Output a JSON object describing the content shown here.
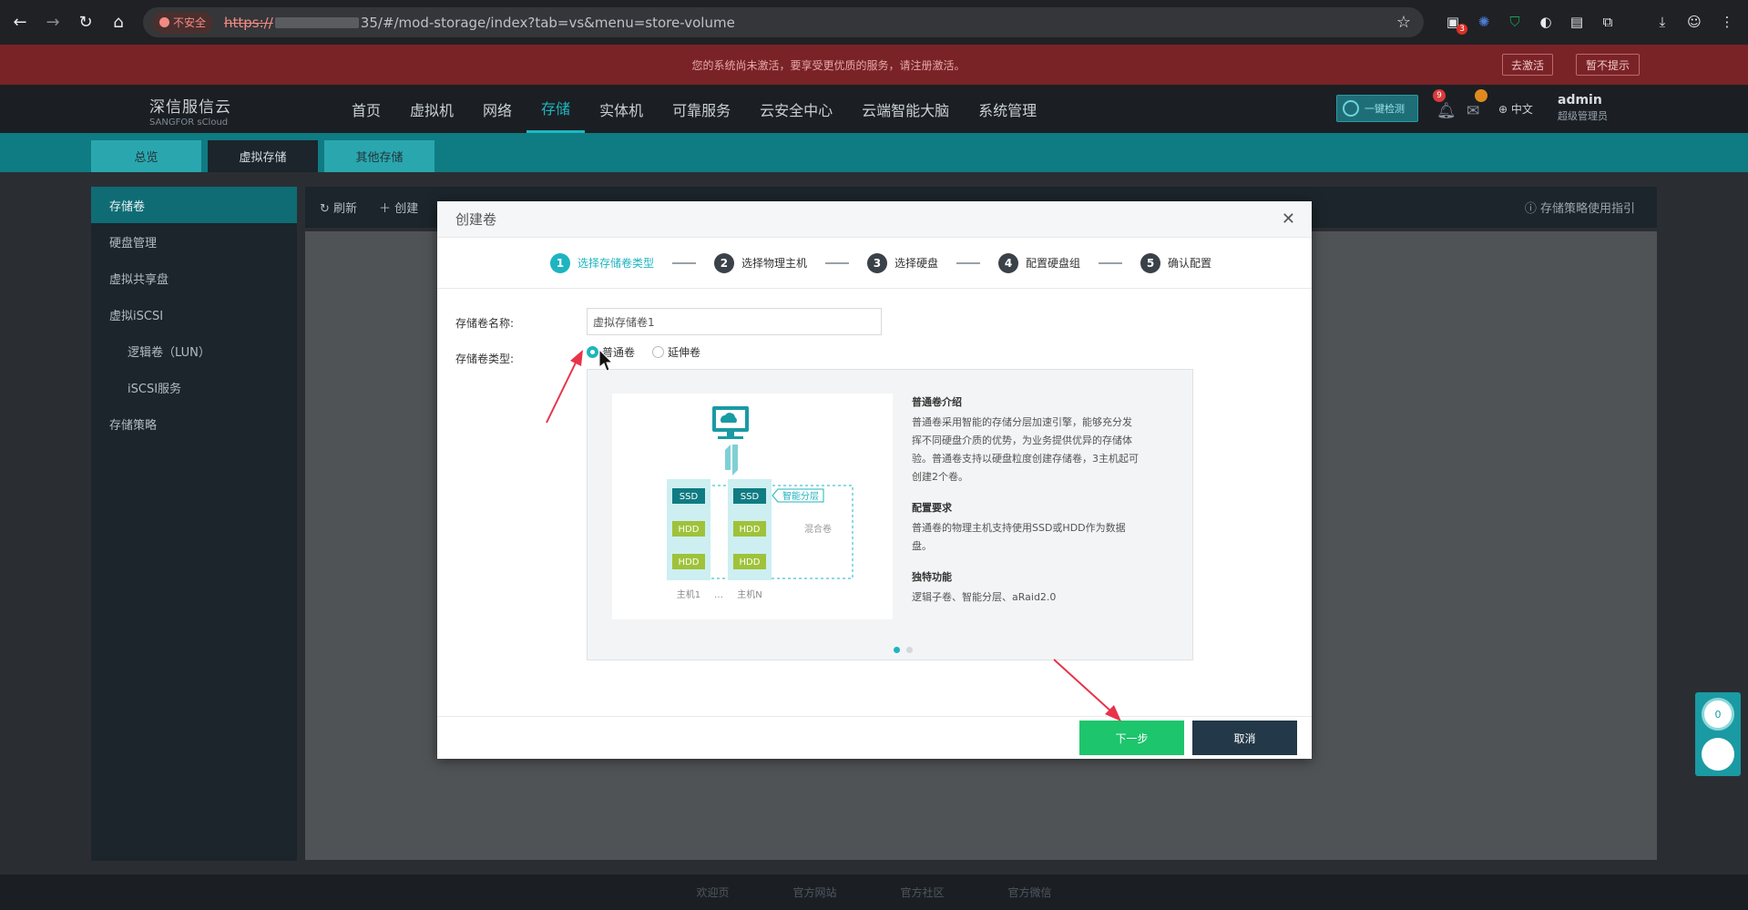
{
  "browser": {
    "insecure_label": "不安全",
    "url_scheme": "https://",
    "url_rest": "35/#/mod-storage/index?tab=vs&menu=store-volume",
    "ext_badge": "3"
  },
  "banner": {
    "text": "您的系统尚未激活，要享受更优质的服务，请注册激活。",
    "activate_label": "去激活",
    "dismiss_label": "暂不提示"
  },
  "header": {
    "brand_cn": "深信服信云",
    "brand_en": "SANGFOR sCloud",
    "nav": [
      "首页",
      "虚拟机",
      "网络",
      "存储",
      "实体机",
      "可靠服务",
      "云安全中心",
      "云端智能大脑",
      "系统管理"
    ],
    "check_label": "一键检测",
    "bell_badge": "9",
    "lang": "中文",
    "user_name": "admin",
    "user_role": "超级管理员"
  },
  "subtabs": [
    "总览",
    "虚拟存储",
    "其他存储"
  ],
  "sidebar": [
    "存储卷",
    "硬盘管理",
    "虚拟共享盘",
    "虚拟iSCSI",
    "逻辑卷（LUN）",
    "iSCSI服务",
    "存储策略"
  ],
  "toolbar": {
    "refresh": "刷新",
    "create": "创建",
    "guide": "存储策略使用指引"
  },
  "footer": [
    "欢迎页",
    "官方网站",
    "官方社区",
    "官方微信"
  ],
  "dialog": {
    "title": "创建卷",
    "steps": [
      {
        "num": "1",
        "label": "选择存储卷类型"
      },
      {
        "num": "2",
        "label": "选择物理主机"
      },
      {
        "num": "3",
        "label": "选择硬盘"
      },
      {
        "num": "4",
        "label": "配置硬盘组"
      },
      {
        "num": "5",
        "label": "确认配置"
      }
    ],
    "name_label": "存储卷名称:",
    "name_value": "虚拟存储卷1",
    "type_label": "存储卷类型:",
    "type_options": [
      "普通卷",
      "延伸卷"
    ],
    "illustration": {
      "ssd": "SSD",
      "hdd": "HDD",
      "tier_label": "智能分层",
      "mixed_label": "混合卷",
      "host1": "主机1",
      "ellipsis": "…",
      "hostN": "主机N"
    },
    "info": [
      {
        "title": "普通卷介绍",
        "body": "普通卷采用智能的存储分层加速引擎，能够充分发挥不同硬盘介质的优势，为业务提供优异的存储体验。普通卷支持以硬盘粒度创建存储卷，3主机起可创建2个卷。"
      },
      {
        "title": "配置要求",
        "body": "普通卷的物理主机支持使用SSD或HDD作为数据盘。"
      },
      {
        "title": "独特功能",
        "body": "逻辑子卷、智能分层、aRaid2.0"
      }
    ],
    "next_label": "下一步",
    "cancel_label": "取消"
  },
  "float_widget": {
    "count": "0"
  },
  "colors": {
    "accent": "#1eb4c0",
    "next": "#1dc56c",
    "banner": "#7a2327"
  }
}
